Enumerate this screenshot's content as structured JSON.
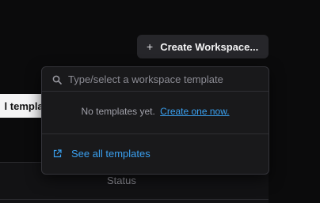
{
  "toolbar": {
    "create_workspace_label": "Create Workspace...",
    "create_icon": "plus-icon",
    "background_templates_label": "l templat"
  },
  "template_dropdown": {
    "search_placeholder": "Type/select a workspace template",
    "search_value": "",
    "search_icon": "search-icon",
    "empty_text": "No templates yet.",
    "create_link_label": "Create one now.",
    "see_all_label": "See all templates",
    "see_all_icon": "external-link-icon"
  },
  "table": {
    "columns": [
      "Status"
    ]
  },
  "colors": {
    "background": "#0b0b0c",
    "dropdown_bg": "#19191b",
    "button_bg": "#26262a",
    "link": "#3aa0f0",
    "muted_text": "#a1a1aa"
  }
}
